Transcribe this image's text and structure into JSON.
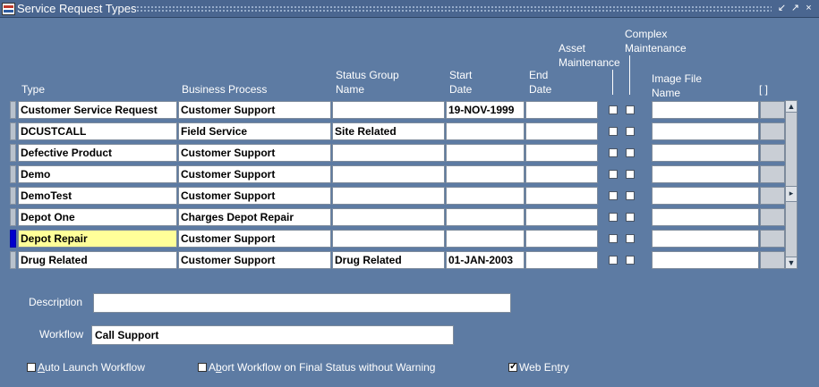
{
  "window": {
    "title": "Service Request Types"
  },
  "columns": {
    "type": "Type",
    "business_process": "Business Process",
    "status_group": "Status Group\nName",
    "start_date": "Start\nDate",
    "end_date": "End\nDate",
    "asset_maintenance": "Asset\nMaintenance",
    "complex_maintenance": "Complex\nMaintenance",
    "image_file": "Image File\nName",
    "flex": "[ ]"
  },
  "rows": [
    {
      "type": "Customer Service Request",
      "business_process": "Customer Support",
      "status_group": "",
      "start_date": "19-NOV-1999",
      "end_date": "",
      "image_file": ""
    },
    {
      "type": "DCUSTCALL",
      "business_process": "Field Service",
      "status_group": "Site Related",
      "start_date": "",
      "end_date": "",
      "image_file": ""
    },
    {
      "type": "Defective Product",
      "business_process": "Customer Support",
      "status_group": "",
      "start_date": "",
      "end_date": "",
      "image_file": ""
    },
    {
      "type": "Demo",
      "business_process": "Customer Support",
      "status_group": "",
      "start_date": "",
      "end_date": "",
      "image_file": ""
    },
    {
      "type": "DemoTest",
      "business_process": "Customer Support",
      "status_group": "",
      "start_date": "",
      "end_date": "",
      "image_file": ""
    },
    {
      "type": "Depot One",
      "business_process": "Charges Depot Repair",
      "status_group": "",
      "start_date": "",
      "end_date": "",
      "image_file": ""
    },
    {
      "type": "Depot Repair",
      "business_process": "Customer Support",
      "status_group": "",
      "start_date": "",
      "end_date": "",
      "image_file": ""
    },
    {
      "type": "Drug Related",
      "business_process": "Customer Support",
      "status_group": "Drug Related",
      "start_date": "01-JAN-2003",
      "end_date": "",
      "image_file": ""
    }
  ],
  "detail": {
    "description_label": "Description",
    "description_value": "",
    "workflow_label": "Workflow",
    "workflow_value": "Call Support"
  },
  "options": {
    "auto_launch": {
      "pre": "",
      "key": "A",
      "post": "uto Launch Workflow",
      "checked": false
    },
    "abort_workflow": {
      "pre": "A",
      "key": "b",
      "post": "ort Workflow on Final Status without Warning",
      "checked": false
    },
    "web_entry": {
      "pre": "Web En",
      "key": "t",
      "post": "ry",
      "checked": true
    }
  }
}
